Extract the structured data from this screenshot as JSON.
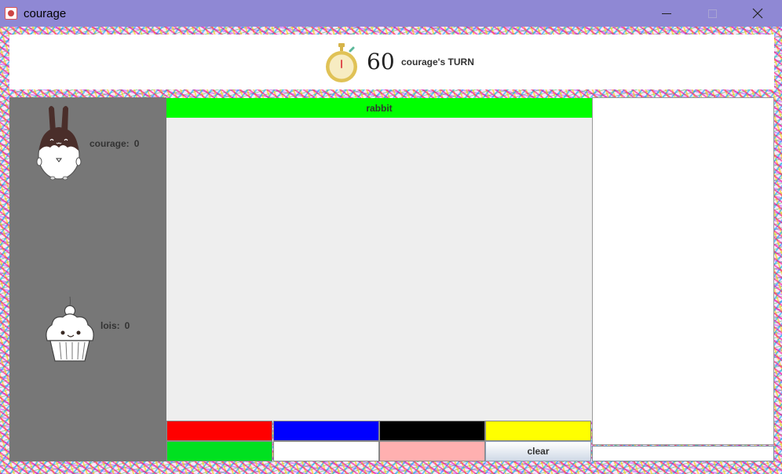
{
  "window": {
    "title": "courage",
    "icon": "java-cup-icon",
    "controls": [
      "minimize-icon",
      "maximize-icon",
      "close-icon"
    ]
  },
  "header": {
    "timer_icon": "stopwatch-icon",
    "timer_value": "60",
    "turn_text": "courage's TURN"
  },
  "players": [
    {
      "avatar": "bunny-avatar",
      "name": "courage:",
      "score": "0"
    },
    {
      "avatar": "cupcake-avatar",
      "name": "lois:",
      "score": "0"
    }
  ],
  "board": {
    "word": "rabbit",
    "word_bar_color": "#00ff00",
    "canvas_color": "#eeeeee"
  },
  "palette": {
    "colors": [
      "#ff0000",
      "#0000ff",
      "#000000",
      "#ffff00",
      "#00e020",
      "#ffffff",
      "#ffb0b0"
    ],
    "clear_label": "clear"
  },
  "chat": {
    "messages": [],
    "input_value": ""
  }
}
